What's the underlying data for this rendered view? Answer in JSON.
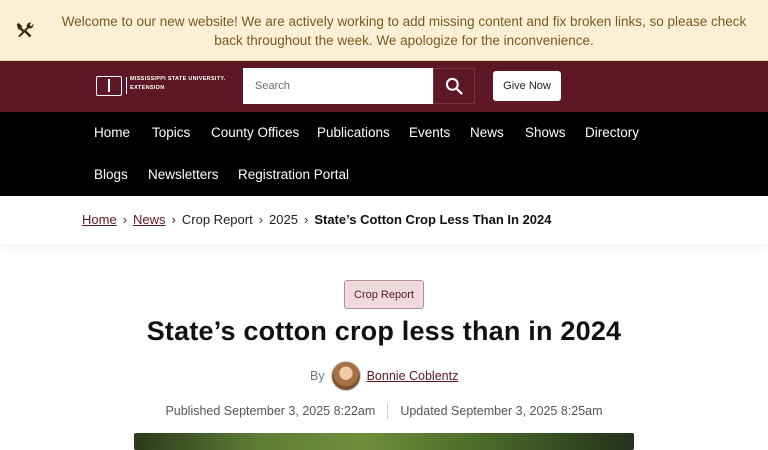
{
  "notice": {
    "message": "Welcome to our new website! We are actively working to add missing content and fix broken links, so please check back throughout the week. We apologize for the inconvenience.",
    "icon": "tools-icon",
    "color": "#7a5a1d",
    "background": "#fbf0d5"
  },
  "header": {
    "logo_line1": "MISSISSIPPI STATE UNIVERSITY.",
    "logo_line2": "EXTENSION",
    "search_placeholder": "Search",
    "search_icon": "search-icon",
    "give_label": "Give Now",
    "brand_color": "#5d1725"
  },
  "nav": {
    "items": [
      {
        "label": "Home"
      },
      {
        "label": "Topics"
      },
      {
        "label": "County Offices"
      },
      {
        "label": "Publications"
      },
      {
        "label": "Events"
      },
      {
        "label": "News"
      },
      {
        "label": "Shows"
      },
      {
        "label": "Directory"
      },
      {
        "label": "Blogs"
      },
      {
        "label": "Newsletters"
      },
      {
        "label": "Registration Portal"
      }
    ]
  },
  "breadcrumb": {
    "items": [
      "Home",
      "News",
      "Crop Report",
      "2025"
    ],
    "current": "State’s Cotton Crop Less Than In 2024"
  },
  "article": {
    "category": "Crop Report",
    "title": "State’s cotton crop less than in 2024",
    "by_label": "By",
    "author": "Bonnie Coblentz",
    "published": "Published September 3, 2025 8:22am",
    "updated": "Updated September 3, 2025 8:25am"
  }
}
